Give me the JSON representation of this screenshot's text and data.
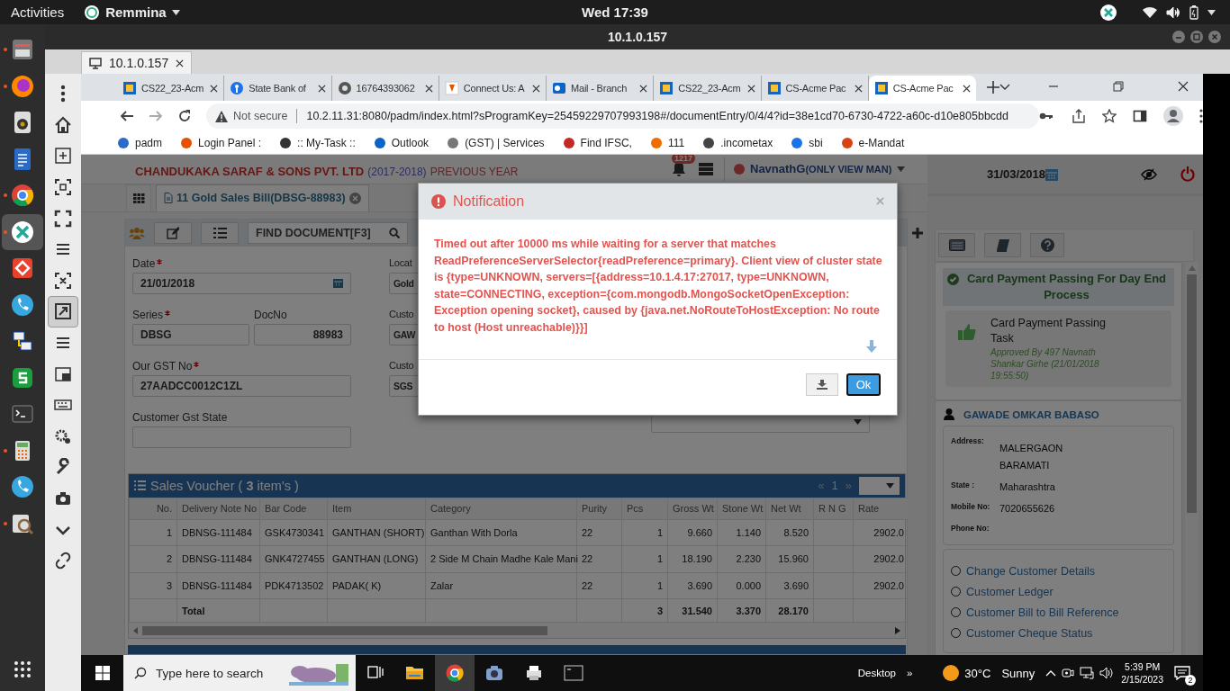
{
  "top_bar": {
    "activities": "Activities",
    "app_menu": "Remmina",
    "clock": "Wed 17:39"
  },
  "remmina": {
    "title": "10.1.0.157",
    "tabs": [
      {
        "label": "10.1.0.157",
        "selected": true
      }
    ]
  },
  "browser": {
    "tabs": [
      {
        "label": "CS22_23-Acm",
        "selected": false
      },
      {
        "label": "State Bank of",
        "selected": false
      },
      {
        "label": "16764393062",
        "selected": false
      },
      {
        "label": "Connect Us: A",
        "selected": false
      },
      {
        "label": "Mail - Branch",
        "selected": false
      },
      {
        "label": "CS22_23-Acm",
        "selected": false
      },
      {
        "label": "CS-Acme Pac",
        "selected": false
      },
      {
        "label": "CS-Acme Pac",
        "selected": true
      }
    ],
    "security": "Not secure",
    "url": "10.2.11.31:8080/padm/index.html?sProgramKey=25459229707993198#/documentEntry/0/4/4?id=38e1cd70-6730-4722-a60c-d10e805bbcdd",
    "bookmarks": [
      "padm",
      "Login Panel :",
      ":: My-Task ::",
      "Outlook",
      "(GST) | Services",
      "Find IFSC,",
      "111",
      ".incometax",
      "sbi",
      "e-Mandat"
    ]
  },
  "app": {
    "company": "CHANDUKAKA SARAF & SONS PVT. LTD",
    "year": "(2017-2018)",
    "year_note": "PREVIOUS YEAR",
    "notification_count": "1217",
    "user": "NavnathG",
    "user_role": "(ONLY VIEW MAN)",
    "date": "31/03/2018",
    "doc_tabs": [
      {
        "label": "11 Gold Sales Bill(DBSG-88983)",
        "selected": true
      }
    ],
    "find_placeholder": "FIND DOCUMENT[F3]",
    "form": {
      "left": [
        [
          {
            "label": "Date",
            "required": true,
            "value": "21/01/2018",
            "kind": "date"
          }
        ],
        [
          {
            "label": "Series",
            "required": true,
            "value": "DBSG",
            "kind": "text"
          },
          {
            "label": "DocNo",
            "required": false,
            "value": "88983",
            "kind": "number"
          }
        ],
        [
          {
            "label": "Our GST No",
            "required": true,
            "value": "27AADCC0012C1ZL",
            "kind": "text"
          }
        ],
        [
          {
            "label": "Customer Gst State",
            "required": false,
            "kind": "text"
          }
        ]
      ],
      "middle": [
        [
          {
            "label": "Locat",
            "value": "Gold"
          }
        ],
        [
          {
            "label": "Custo",
            "value": "GAW"
          }
        ],
        [
          {
            "label": "Custo",
            "value": "SGS"
          }
        ]
      ],
      "right": [
        {
          "kind": "select"
        }
      ]
    },
    "sales_voucher": {
      "title": "Sales Voucher ( **3** item's )",
      "pager": [
        "«",
        "1",
        "»"
      ],
      "columns": [
        "No.",
        "Delivery Note No",
        "Bar Code",
        "Item",
        "Category",
        "Purity",
        "Pcs",
        "Gross Wt",
        "Stone Wt",
        "Net Wt",
        "R N G",
        "Rate"
      ],
      "rows": [
        {
          "no": "1",
          "delivery_note_no": "DBNSG-111484",
          "bar_code": "GSK4730341",
          "item": "GANTHAN (SHORT)",
          "category": "Ganthan With Dorla",
          "purity": "22",
          "pcs": "1",
          "gross_wt": "9.660",
          "stone_wt": "1.140",
          "net_wt": "8.520",
          "rate": "2902.0"
        },
        {
          "no": "2",
          "delivery_note_no": "DBNSG-111484",
          "bar_code": "GNK4727455",
          "item": "GANTHAN (LONG)",
          "category": "2 Side M Chain Madhe Kale Mani",
          "purity": "22",
          "pcs": "1",
          "gross_wt": "18.190",
          "stone_wt": "2.230",
          "net_wt": "15.960",
          "rate": "2902.0"
        },
        {
          "no": "3",
          "delivery_note_no": "DBNSG-111484",
          "bar_code": "PDK4713502",
          "item": "PADAK( K)",
          "category": "Zalar",
          "purity": "22",
          "pcs": "1",
          "gross_wt": "3.690",
          "stone_wt": "0.000",
          "net_wt": "3.690",
          "rate": "2902.0"
        }
      ],
      "total": {
        "delivery_note_no": "Total",
        "pcs": "3",
        "gross_wt": "31.540",
        "stone_wt": "3.370",
        "net_wt": "28.170"
      }
    },
    "day_end": {
      "title": "Card Payment Passing For Day End Process",
      "task": "Card Payment Passing Task",
      "approved": "Approved By 497 Navnath Shankar Girhe (21/01/2018 19:55:50)"
    },
    "customer": {
      "name": "GAWADE OMKAR BABASO",
      "details": [
        {
          "label": "Address:",
          "lines": [
            "MALERGAON",
            "BARAMATI"
          ]
        },
        {
          "label": "State :",
          "lines": [
            "Maharashtra"
          ]
        },
        {
          "label": "Mobile No:",
          "lines": [
            "7020655626"
          ]
        },
        {
          "label": "Phone No:"
        }
      ]
    },
    "actions": [
      {
        "label": "Change Customer Details",
        "selected": false
      },
      {
        "label": "Customer Ledger",
        "selected": false
      },
      {
        "label": "Customer Bill to Bill Reference",
        "selected": false
      },
      {
        "label": "Customer Cheque Status",
        "selected": false
      }
    ]
  },
  "modal": {
    "title": "Notification",
    "message": "Timed out after 10000 ms while waiting for a server that matches ReadPreferenceServerSelector{readPreference=primary}. Client view of cluster state is {type=UNKNOWN, servers=[{address=10.1.4.17:27017, type=UNKNOWN, state=CONNECTING, exception={com.mongodb.MongoSocketOpenException: Exception opening socket}, caused by {java.net.NoRouteToHostException: No route to host (Host unreachable)}}]",
    "ok": "Ok"
  },
  "taskbar": {
    "search_placeholder": "Type here to search",
    "desktop": "Desktop",
    "chevron": "»",
    "temperature": "30°C",
    "condition": "Sunny",
    "time": "5:39 PM",
    "date": "2/15/2023",
    "notification_count": "2"
  }
}
